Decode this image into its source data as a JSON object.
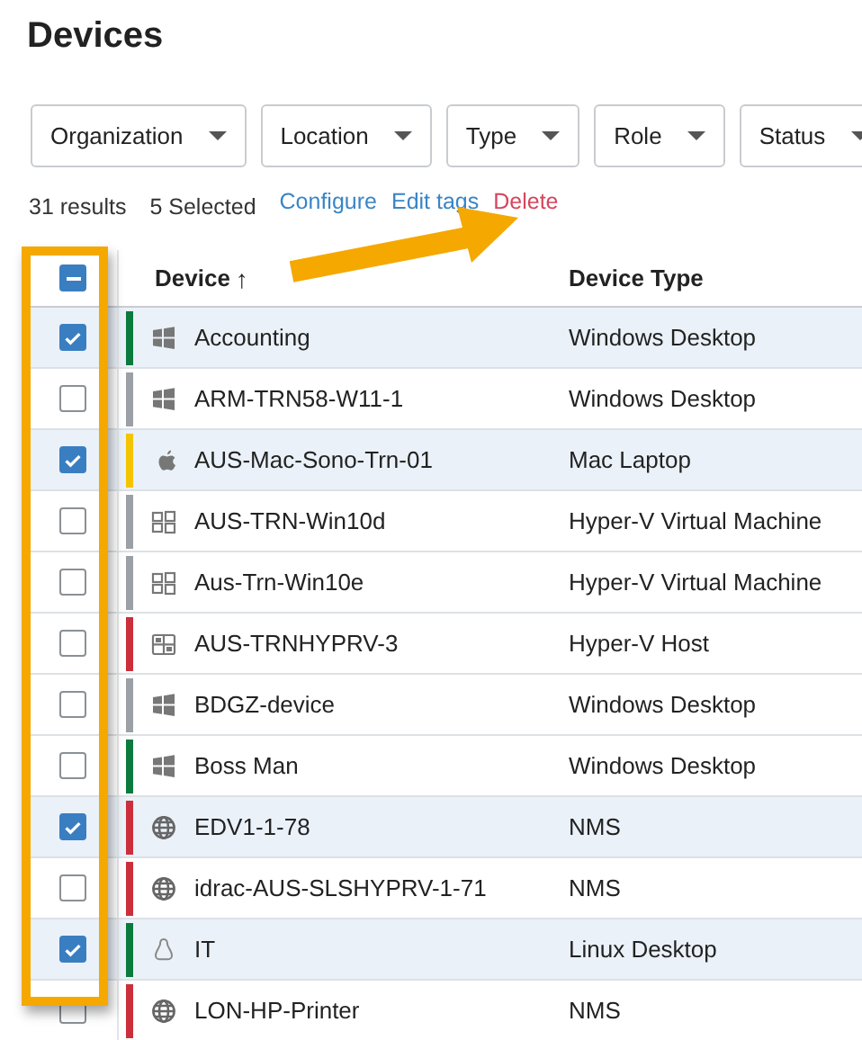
{
  "page": {
    "title": "Devices"
  },
  "filters": [
    {
      "label": "Organization"
    },
    {
      "label": "Location"
    },
    {
      "label": "Type"
    },
    {
      "label": "Role"
    },
    {
      "label": "Status"
    }
  ],
  "summary": {
    "results": "31 results",
    "selected": "5 Selected"
  },
  "actions": [
    {
      "label": "Configure",
      "kind": "link"
    },
    {
      "label": "Edit tags",
      "kind": "link"
    },
    {
      "label": "Delete",
      "kind": "danger"
    }
  ],
  "table": {
    "select_all": {
      "indeterminate": true
    },
    "columns": [
      {
        "label": "Device",
        "sort": "↑"
      },
      {
        "label": "Device Type"
      }
    ],
    "rows": [
      {
        "selected": true,
        "color": "#0a7a3e",
        "kind": "windows",
        "device": "Accounting",
        "type": "Windows Desktop"
      },
      {
        "selected": false,
        "color": "#9aa0a6",
        "kind": "windows",
        "device": "ARM-TRN58-W11-1",
        "type": "Windows Desktop"
      },
      {
        "selected": true,
        "color": "#f5c400",
        "kind": "apple",
        "device": "AUS-Mac-Sono-Trn-01",
        "type": "Mac Laptop"
      },
      {
        "selected": false,
        "color": "#9aa0a6",
        "kind": "vm",
        "device": "AUS-TRN-Win10d",
        "type": "Hyper-V Virtual Machine"
      },
      {
        "selected": false,
        "color": "#9aa0a6",
        "kind": "vm",
        "device": "Aus-Trn-Win10e",
        "type": "Hyper-V Virtual Machine"
      },
      {
        "selected": false,
        "color": "#cc2e3b",
        "kind": "host",
        "device": "AUS-TRNHYPRV-3",
        "type": "Hyper-V Host"
      },
      {
        "selected": false,
        "color": "#9aa0a6",
        "kind": "windows",
        "device": "BDGZ-device",
        "type": "Windows Desktop"
      },
      {
        "selected": false,
        "color": "#0a7a3e",
        "kind": "windows",
        "device": "Boss Man",
        "type": "Windows Desktop"
      },
      {
        "selected": true,
        "color": "#cc2e3b",
        "kind": "globe",
        "device": "EDV1-1-78",
        "type": "NMS"
      },
      {
        "selected": false,
        "color": "#cc2e3b",
        "kind": "globe",
        "device": "idrac-AUS-SLSHYPRV-1-71",
        "type": "NMS"
      },
      {
        "selected": true,
        "color": "#0a7a3e",
        "kind": "linux",
        "device": "IT",
        "type": "Linux Desktop"
      },
      {
        "selected": false,
        "color": "#cc2e3b",
        "kind": "globe",
        "device": "LON-HP-Printer",
        "type": "NMS"
      }
    ]
  }
}
